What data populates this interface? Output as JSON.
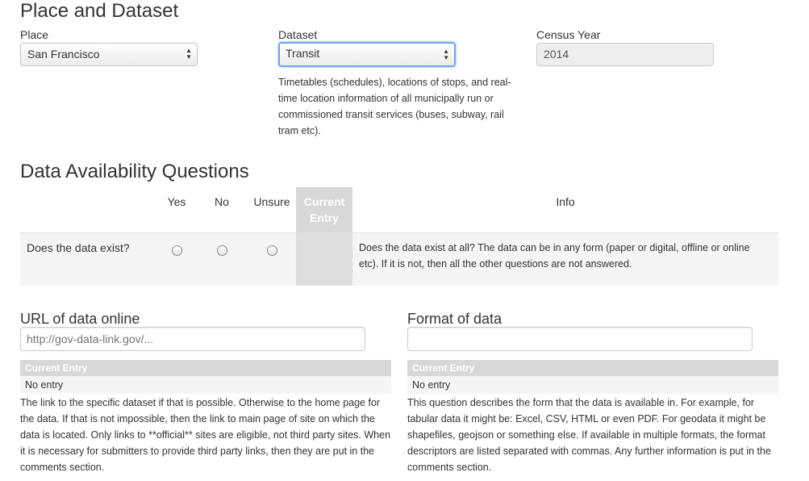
{
  "sections": {
    "place_dataset_title": "Place and Dataset",
    "availability_title": "Data Availability Questions"
  },
  "place": {
    "label": "Place",
    "value": "San Francisco"
  },
  "dataset": {
    "label": "Dataset",
    "value": "Transit",
    "description": "Timetables (schedules), locations of stops, and real-time location information of all municipally run or commissioned transit services (buses, subway, rail tram etc)."
  },
  "census_year": {
    "label": "Census Year",
    "value": "2014"
  },
  "questions_table": {
    "headers": {
      "yes": "Yes",
      "no": "No",
      "unsure": "Unsure",
      "current": "Current Entry",
      "info": "Info"
    },
    "rows": [
      {
        "question": "Does the data exist?",
        "info": "Does the data exist at all? The data can be in any form (paper or digital, offline or online etc). If it is not, then all the other questions are not answered."
      }
    ]
  },
  "url_field": {
    "label": "URL of data online",
    "placeholder": "http://gov-data-link.gov/...",
    "value": "",
    "current_entry_header": "Current Entry",
    "current_entry_value": "No entry",
    "help": "The link to the specific dataset if that is possible. Otherwise to the home page for the data. If that is not impossible, then the link to main page of site on which the data is located. Only links to **official** sites are eligible, not third party sites. When it is necessary for submitters to provide third party links, then they are put in the comments section."
  },
  "format_field": {
    "label": "Format of data",
    "placeholder": "",
    "value": "",
    "current_entry_header": "Current Entry",
    "current_entry_value": "No entry",
    "help": "This question describes the form that the data is available in. For example, for tabular data it might be: Excel, CSV, HTML or even PDF. For geodata it might be shapefiles, geojson or something else. If available in multiple formats, the format descriptors are listed separated with commas. Any further information is put in the comments section."
  },
  "colors": {
    "focus_border": "#6ea6e8",
    "current_entry_bg": "#d8d8d8",
    "row_bg": "#f5f5f5"
  }
}
